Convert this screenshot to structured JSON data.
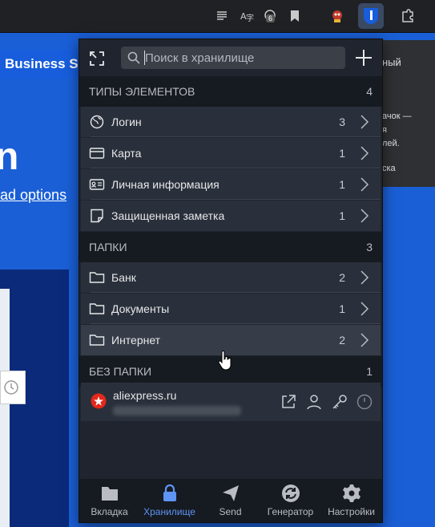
{
  "background": {
    "business_text": "Business Sa",
    "big_text": "n",
    "link_text": "ad options"
  },
  "tooltip": {
    "line1": "ный",
    "line2": "ачок —",
    "line3": "я",
    "line4": "лей.",
    "line5": "ска"
  },
  "toolbar": {
    "badge_count": "6"
  },
  "search": {
    "placeholder": "Поиск в хранилище"
  },
  "sections": {
    "types": {
      "title": "ТИПЫ ЭЛЕМЕНТОВ",
      "count": "4"
    },
    "folders": {
      "title": "ПАПКИ",
      "count": "3"
    },
    "no_folder": {
      "title": "БЕЗ ПАПКИ",
      "count": "1"
    }
  },
  "types": [
    {
      "label": "Логин",
      "count": "3",
      "icon": "globe-icon"
    },
    {
      "label": "Карта",
      "count": "1",
      "icon": "card-icon"
    },
    {
      "label": "Личная информация",
      "count": "1",
      "icon": "id-card-icon"
    },
    {
      "label": "Защищенная заметка",
      "count": "1",
      "icon": "note-icon"
    }
  ],
  "folders": [
    {
      "label": "Банк",
      "count": "2",
      "icon": "folder-icon"
    },
    {
      "label": "Документы",
      "count": "1",
      "icon": "folder-icon"
    },
    {
      "label": "Интернет",
      "count": "2",
      "icon": "folder-icon"
    }
  ],
  "item": {
    "name": "aliexpress.ru"
  },
  "nav": [
    {
      "label": "Вкладка",
      "icon": "folder-tab-icon"
    },
    {
      "label": "Хранилище",
      "icon": "lock-icon"
    },
    {
      "label": "Send",
      "icon": "send-icon"
    },
    {
      "label": "Генератор",
      "icon": "generator-icon"
    },
    {
      "label": "Настройки",
      "icon": "gear-icon"
    }
  ],
  "colors": {
    "accent": "#5e95f4",
    "page_blue": "#1a5fd6",
    "popup_bg": "#1f242e",
    "row_bg": "#2a303b"
  }
}
